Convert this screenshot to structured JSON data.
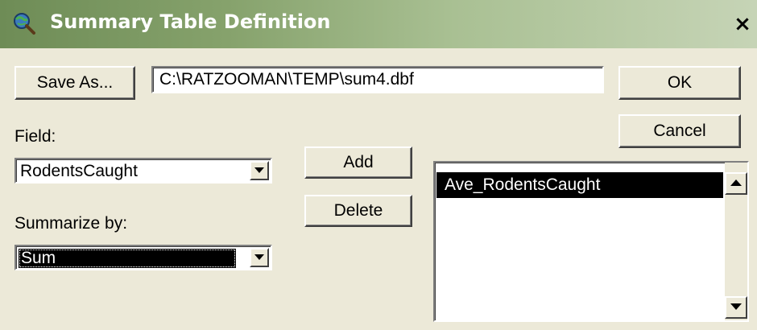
{
  "window": {
    "title": "Summary Table Definition",
    "close_glyph": "×",
    "icon": "globe-magnifier-icon"
  },
  "output": {
    "save_as_label": "Save As...",
    "path_value": "C:\\RATZOOMAN\\TEMP\\sum4.dbf"
  },
  "buttons": {
    "ok_label": "OK",
    "cancel_label": "Cancel",
    "add_label": "Add",
    "delete_label": "Delete"
  },
  "field": {
    "label": "Field:",
    "selected_value": "RodentsCaught"
  },
  "summarize": {
    "label": "Summarize by:",
    "selected_value": "Sum"
  },
  "summary_list": {
    "items": [
      {
        "label": "Ave_RodentsCaught",
        "selected": true
      }
    ]
  },
  "colors": {
    "titlebar_start": "#6e8c56",
    "titlebar_end": "#c6d4b6",
    "dialog_face": "#ece9d8",
    "selection": "#000000"
  }
}
